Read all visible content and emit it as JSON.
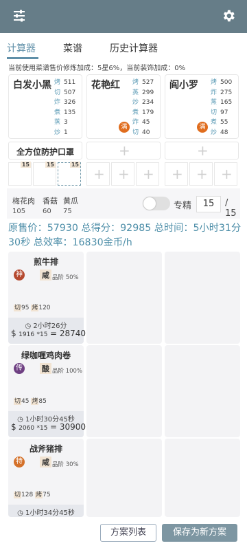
{
  "tabs": [
    "计算器",
    "菜谱",
    "历史计算器"
  ],
  "notice": "当前使用菜谱售价修炼加成：5星6%，当前装饰加成：0%",
  "chefs": [
    {
      "name": "白发小黑",
      "badge": "",
      "stats": [
        [
          "烤",
          "511"
        ],
        [
          "切",
          "507"
        ],
        [
          "炸",
          "326"
        ],
        [
          "煮",
          "135"
        ],
        [
          "蒸",
          "3"
        ],
        [
          "炒",
          "1"
        ]
      ]
    },
    {
      "name": "花艳红",
      "badge": "满",
      "stats": [
        [
          "烤",
          "527"
        ],
        [
          "蒸",
          "299"
        ],
        [
          "炒",
          "234"
        ],
        [
          "煮",
          "179"
        ],
        [
          "炸",
          "45"
        ],
        [
          "切",
          "40"
        ]
      ]
    },
    {
      "name": "阎小罗",
      "badge": "满",
      "stats": [
        [
          "烤",
          "500"
        ],
        [
          "炸",
          "275"
        ],
        [
          "蒸",
          "165"
        ],
        [
          "切",
          "97"
        ],
        [
          "煮",
          "55"
        ],
        [
          "炒",
          "48"
        ]
      ]
    }
  ],
  "equipment": [
    "全方位防护口罩",
    "",
    ""
  ],
  "slots": [
    "15",
    "15",
    "15"
  ],
  "ingredients": [
    {
      "name": "梅花肉",
      "qty": "105"
    },
    {
      "name": "香菇",
      "qty": "60"
    },
    {
      "name": "黄瓜",
      "qty": "75"
    }
  ],
  "specialty_label": "专精",
  "quantity": "15",
  "quantity_max": "/ 15",
  "summary": "原售价：57930 总得分：92985 总时间：5小时31分30秒 总效率：16830金币/h",
  "recipes": [
    {
      "name": "煎牛排",
      "rarity": "神",
      "rarity_color": "#b5492f",
      "flavor": "咸",
      "grade": "品阶 50%",
      "skills": [
        [
          "切",
          "95"
        ],
        [
          "烤",
          "120"
        ]
      ],
      "time": "2小时26分",
      "price_unit": "1916",
      "price_mult": "*15",
      "price_total": "= 28740"
    },
    {
      "name": "绿咖喱鸡肉卷",
      "rarity": "传",
      "rarity_color": "#6e3f82",
      "flavor": "酸",
      "grade": "品阶 100%",
      "skills": [
        [
          "切",
          "45"
        ],
        [
          "烤",
          "85"
        ]
      ],
      "time": "1小时30分45秒",
      "price_unit": "2060",
      "price_mult": "*15",
      "price_total": "= 30900"
    },
    {
      "name": "战斧猪排",
      "rarity": "特",
      "rarity_color": "#d4712a",
      "flavor": "咸",
      "grade": "品阶 30%",
      "skills": [
        [
          "切",
          "128"
        ],
        [
          "烤",
          "75"
        ]
      ],
      "time": "1小时34分45秒",
      "price_unit": "",
      "price_mult": "",
      "price_total": ""
    }
  ],
  "buttons": {
    "plan_list": "方案列表",
    "save_new": "保存为新方案"
  }
}
